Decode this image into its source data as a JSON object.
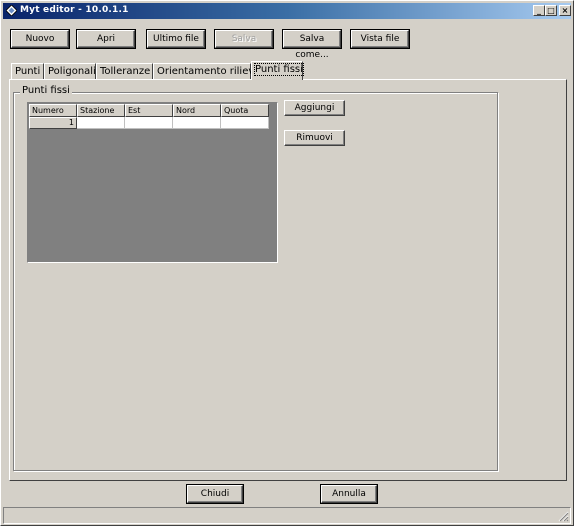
{
  "window": {
    "title": "Myt editor - 10.0.1.1",
    "controls": {
      "minimize": "_",
      "maximize": "□",
      "close": "×"
    }
  },
  "toolbar": {
    "nuovo": "Nuovo",
    "apri": "Apri",
    "ultimo_file": "Ultimo file",
    "salva": "Salva",
    "salva_come": "Salva come...",
    "vista_file": "Vista file"
  },
  "tabs": [
    {
      "label": "Punti"
    },
    {
      "label": "Poligonali"
    },
    {
      "label": "Tolleranze"
    },
    {
      "label": "Orientamento rilievo"
    },
    {
      "label": "Punti fissi",
      "active": true
    }
  ],
  "group": {
    "label": "Punti fissi"
  },
  "grid": {
    "columns": [
      "Numero",
      "Stazione",
      "Est",
      "Nord",
      "Quota"
    ],
    "rows": [
      {
        "numero": "1",
        "stazione": "",
        "est": "",
        "nord": "",
        "quota": ""
      }
    ]
  },
  "side_buttons": {
    "aggiungi": "Aggiungi",
    "rimuovi": "Rimuovi"
  },
  "footer": {
    "chiudi": "Chiudi",
    "annulla": "Annulla"
  },
  "colors": {
    "face": "#d4d0c8",
    "titlebar": "#0a246a",
    "grid_empty": "#808080"
  },
  "icons": {
    "app": "diamond-app-icon",
    "grip": "size-grip-icon"
  }
}
